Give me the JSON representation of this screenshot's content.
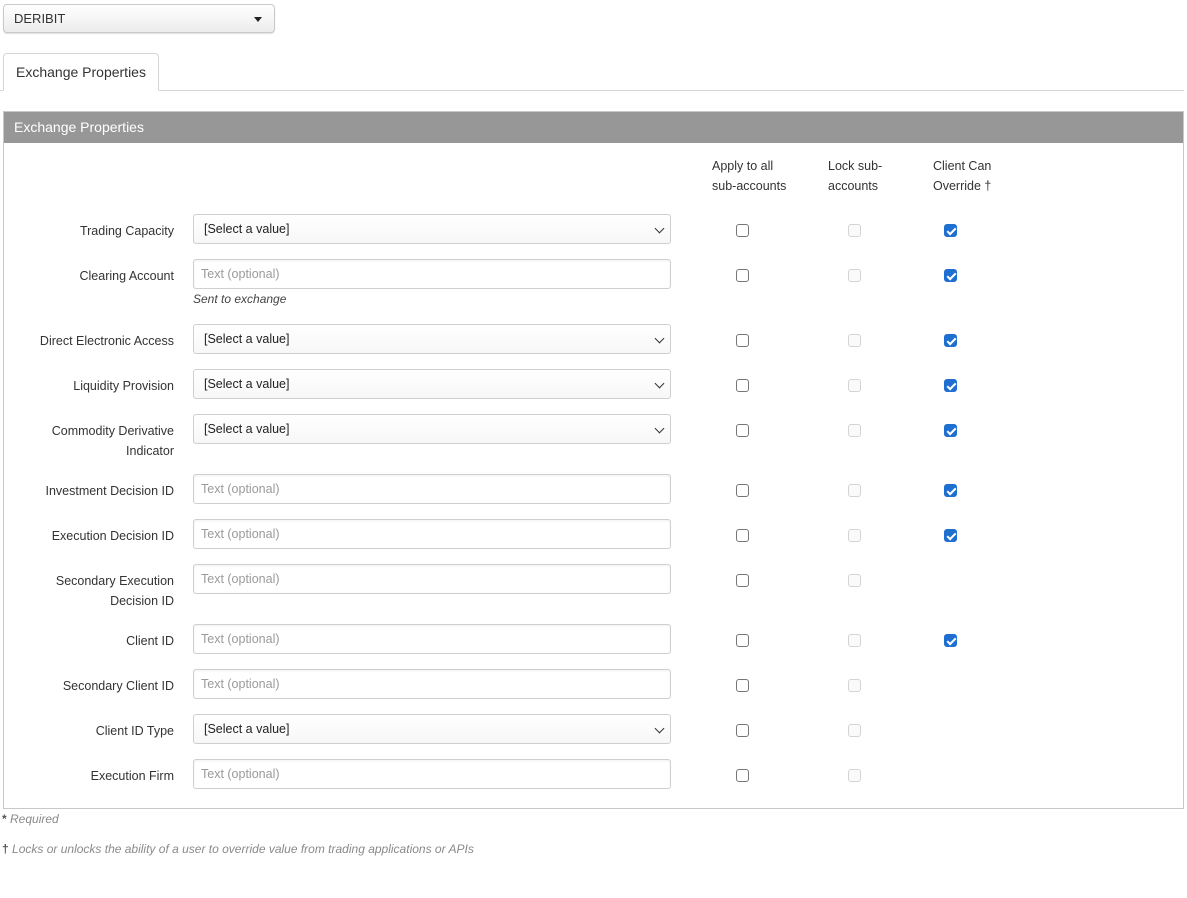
{
  "exchange_select": {
    "value": "DERIBIT"
  },
  "tabs": [
    {
      "label": "Exchange Properties"
    }
  ],
  "panel": {
    "title": "Exchange Properties",
    "columns": {
      "apply": [
        "Apply to all",
        "sub-accounts"
      ],
      "lock": [
        "Lock sub-",
        "accounts"
      ],
      "client": [
        "Client Can",
        "Override †"
      ]
    },
    "rows": [
      {
        "label": [
          "Trading Capacity"
        ],
        "control": "select",
        "value": "[Select a value]",
        "apply": false,
        "lock": false,
        "client_override": true
      },
      {
        "label": [
          "Clearing Account"
        ],
        "control": "text",
        "placeholder": "Text (optional)",
        "help": "Sent to exchange",
        "apply": false,
        "lock": false,
        "client_override": true
      },
      {
        "label": [
          "Direct Electronic Access"
        ],
        "control": "select",
        "value": "[Select a value]",
        "apply": false,
        "lock": false,
        "client_override": true
      },
      {
        "label": [
          "Liquidity Provision"
        ],
        "control": "select",
        "value": "[Select a value]",
        "apply": false,
        "lock": false,
        "client_override": true
      },
      {
        "label": [
          "Commodity Derivative",
          "Indicator"
        ],
        "control": "select",
        "value": "[Select a value]",
        "apply": false,
        "lock": false,
        "client_override": true
      },
      {
        "label": [
          "Investment Decision ID"
        ],
        "control": "text",
        "placeholder": "Text (optional)",
        "apply": false,
        "lock": false,
        "client_override": true
      },
      {
        "label": [
          "Execution Decision ID"
        ],
        "control": "text",
        "placeholder": "Text (optional)",
        "apply": false,
        "lock": false,
        "client_override": true
      },
      {
        "label": [
          "Secondary Execution",
          "Decision ID"
        ],
        "control": "text",
        "placeholder": "Text (optional)",
        "apply": false,
        "lock": false,
        "client_override": null
      },
      {
        "label": [
          "Client ID"
        ],
        "control": "text",
        "placeholder": "Text (optional)",
        "apply": false,
        "lock": false,
        "client_override": true
      },
      {
        "label": [
          "Secondary Client ID"
        ],
        "control": "text",
        "placeholder": "Text (optional)",
        "apply": false,
        "lock": false,
        "client_override": null
      },
      {
        "label": [
          "Client ID Type"
        ],
        "control": "select",
        "value": "[Select a value]",
        "apply": false,
        "lock": false,
        "client_override": null
      },
      {
        "label": [
          "Execution Firm"
        ],
        "control": "text",
        "placeholder": "Text (optional)",
        "apply": false,
        "lock": false,
        "client_override": null
      }
    ]
  },
  "footnotes": {
    "required_mark": "*",
    "required": "Required",
    "override_mark": "†",
    "override": "Locks or unlocks the ability of a user to override value from trading applications or APIs"
  },
  "colors": {
    "header_bg": "#979797",
    "checkbox_checked": "#1f6fd1",
    "border": "#cfcfcf"
  }
}
